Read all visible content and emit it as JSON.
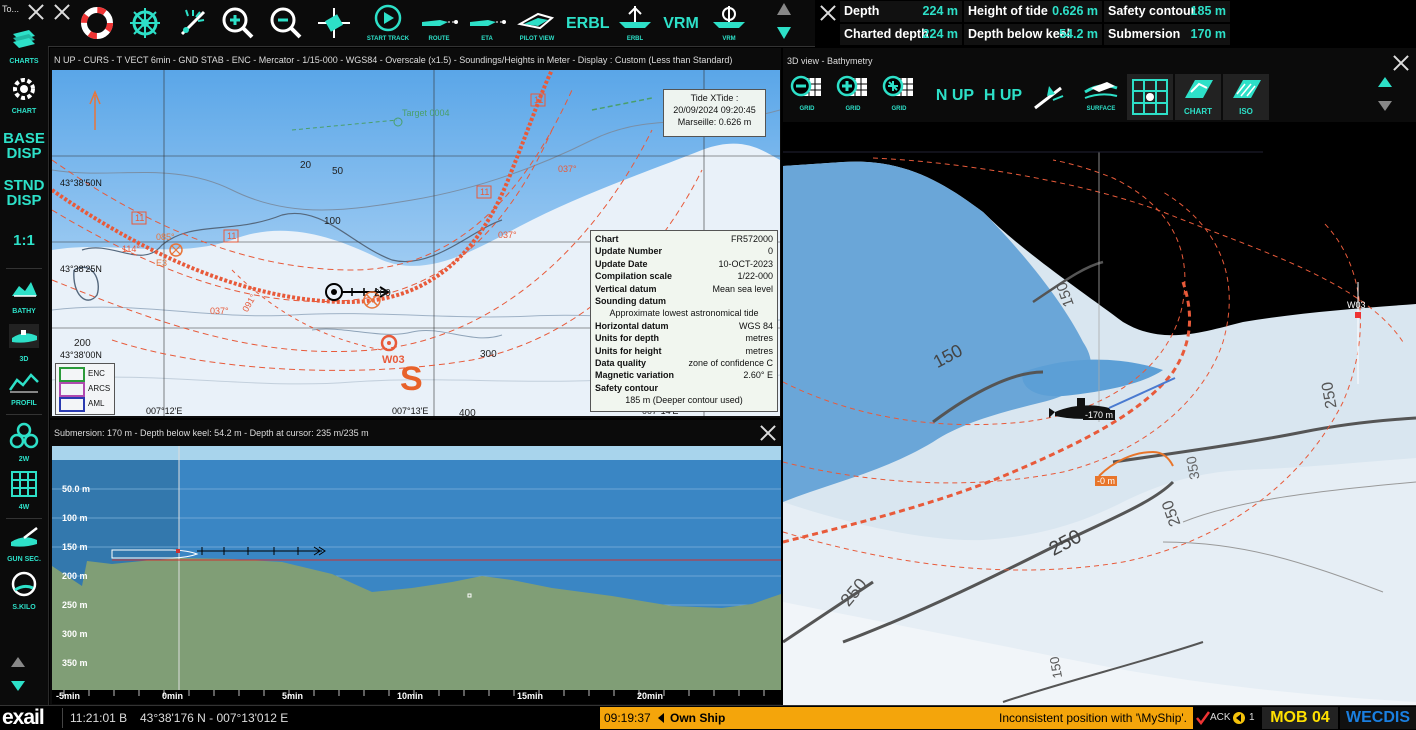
{
  "app": {
    "corner_label": "To...",
    "logo": "exail"
  },
  "left_toolbar": {
    "charts": "CHARTS",
    "chart": "CHART",
    "base_disp_1": "BASE",
    "base_disp_2": "DISP",
    "stnd_disp_1": "STND",
    "stnd_disp_2": "DISP",
    "scale": "1:1",
    "bathy": "BATHY",
    "view3d": "3D",
    "profil": "PROFIL",
    "w2": "2W",
    "w4": "4W",
    "gun_sec": "GUN SEC.",
    "skilo": "S.KILO"
  },
  "top_toolbar": {
    "start_track": "START TRACK",
    "route": "ROUTE",
    "eta": "ETA",
    "pilot_view": "PILOT VIEW",
    "erbl_text": "ERBL",
    "erbl_icon": "ERBL",
    "vrm_text": "VRM",
    "vrm_icon": "VRM"
  },
  "info_panel": {
    "depth_label": "Depth",
    "depth_value": "224 m",
    "height_of_tide_label": "Height of tide",
    "height_of_tide_value": "0.626 m",
    "safety_contour_label": "Safety contour",
    "safety_contour_value": "185 m",
    "charted_depth_label": "Charted depth",
    "charted_depth_value": "224 m",
    "depth_below_keel_label": "Depth below keel",
    "depth_below_keel_value": "54.2 m",
    "submersion_label": "Submersion",
    "submersion_value": "170 m"
  },
  "chart_window": {
    "title": "N UP - CURS - T VECT 6min - GND STAB - ENC - Mercator - 1/15-000 - WGS84 - Overscale (x1.5) - Soundings/Heights in Meter - Display : Custom (Less than Standard)",
    "lat_labels": [
      "43°38'50N",
      "43°38'25N",
      "43°38'00N"
    ],
    "lon_labels": [
      "007°12'E",
      "007°13'E",
      "007°14'E"
    ],
    "depth_labels": [
      "20",
      "50",
      "100",
      "200",
      "200",
      "300",
      "400"
    ],
    "bearing_labels": [
      "037°",
      "037°",
      "037°",
      "114°",
      "091°"
    ],
    "route_boxes": [
      "11",
      "11",
      "11",
      "11"
    ],
    "target_label": "Target 0004",
    "waypoint_label": "W03",
    "s_label": "S",
    "e_label": "E3",
    "bearing_orange": "085°",
    "tide": {
      "title": "Tide XTide :",
      "datetime": "20/09/2024 09:20:45",
      "place": "Marseille: 0.626 m"
    },
    "legend": [
      "ENC",
      "ARCS",
      "AML"
    ],
    "chart_info": {
      "rows": [
        {
          "k": "Chart",
          "v": "FR572000"
        },
        {
          "k": "Update Number",
          "v": "0"
        },
        {
          "k": "Update Date",
          "v": "10-OCT-2023"
        },
        {
          "k": "Compilation scale",
          "v": "1/22-000"
        },
        {
          "k": "Vertical datum",
          "v": "Mean sea level"
        },
        {
          "k": "Sounding datum",
          "v": ""
        }
      ],
      "sounding_datum_value": "Approximate lowest astronomical tide",
      "rows2": [
        {
          "k": "Horizontal datum",
          "v": "WGS 84"
        },
        {
          "k": "Units for depth",
          "v": "metres"
        },
        {
          "k": "Units for height",
          "v": "metres"
        },
        {
          "k": "Data quality",
          "v": "zone of confidence C"
        },
        {
          "k": "Magnetic variation",
          "v": "2.60° E"
        },
        {
          "k": "Safety contour",
          "v": ""
        }
      ],
      "safety_contour_value": "185 m (Deeper contour used)"
    }
  },
  "profile_window": {
    "title": "Submersion: 170 m - Depth below keel: 54.2 m - Depth at cursor: 235 m/235 m",
    "y_labels": [
      "50.0 m",
      "100 m",
      "150 m",
      "200 m",
      "250 m",
      "300 m",
      "350 m"
    ],
    "x_labels": [
      "-5min",
      "0min",
      "5min",
      "10min",
      "15min",
      "20min"
    ]
  },
  "window_3d": {
    "title": "3D view - Bathymetry",
    "grid1": "GRID",
    "grid2": "GRID",
    "grid3": "GRID",
    "n_up": "N UP",
    "h_up": "H UP",
    "surface": "SURFACE",
    "chart": "CHART",
    "iso": "ISO",
    "contours": [
      "150",
      "150",
      "250",
      "250",
      "250",
      "250",
      "350",
      "150"
    ],
    "sub_depth": "-170 m",
    "orange_depth": "-0 m",
    "waypoint": "W03"
  },
  "status_bar": {
    "time": "11:21:01 B",
    "position": "43°38'176 N - 007°13'012 E",
    "alarm_time": "09:19:37",
    "alarm_source": "Own Ship",
    "alarm_text": "Inconsistent position with '\\MyShip'.",
    "ack": "ACK",
    "count": "1",
    "mob": "MOB 04",
    "wecdis": "WECDIS"
  },
  "colors": {
    "accent": "#2de0c8",
    "route_red": "#e85a3a",
    "alarm_orange": "#f4a50b",
    "mob_yellow": "#ffe000",
    "wecdis_blue": "#1a7fe0"
  }
}
